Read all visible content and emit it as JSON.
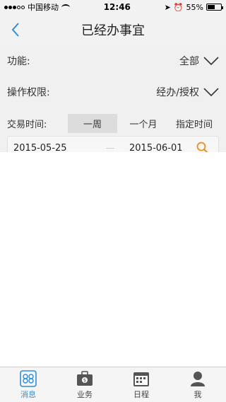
{
  "status_bar": {
    "carrier": "中国移动",
    "time": "12:46",
    "battery": "55%",
    "battery_level": 0.55
  },
  "navbar": {
    "title": "已经办事宜"
  },
  "filters": {
    "function": {
      "label": "功能:",
      "value": "全部"
    },
    "permission": {
      "label": "操作权限:",
      "value": "经办/授权"
    }
  },
  "range": {
    "label": "交易时间:",
    "tabs": [
      "一周",
      "一个月",
      "指定时间"
    ],
    "active_index": 0
  },
  "dates": {
    "start": "2015-05-25",
    "separator": "—",
    "end": "2015-06-01"
  },
  "tabbar": {
    "items": [
      {
        "label": "消息",
        "icon": "message-icon"
      },
      {
        "label": "业务",
        "icon": "briefcase-icon"
      },
      {
        "label": "日程",
        "icon": "calendar-icon"
      },
      {
        "label": "我",
        "icon": "person-icon"
      }
    ],
    "active_index": 0
  },
  "colors": {
    "accent": "#2e8fd6",
    "search": "#f08c1a"
  }
}
